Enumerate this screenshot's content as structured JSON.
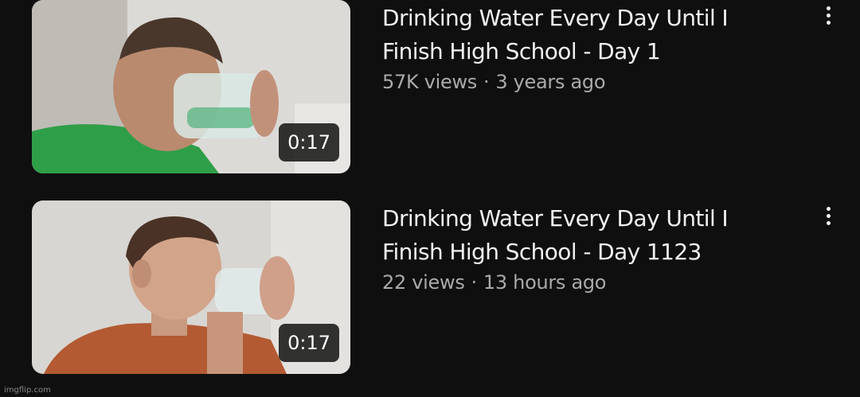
{
  "videos": [
    {
      "title_line1": "Drinking Water Every Day Until I",
      "title_line2": "Finish High School - Day 1",
      "views": "57K views",
      "age": "3 years ago",
      "duration": "0:17",
      "menu_icon": "more-vert-icon"
    },
    {
      "title_line1": "Drinking Water Every Day Until I",
      "title_line2": "Finish High School - Day 1123",
      "views": "22 views",
      "age": "13 hours ago",
      "duration": "0:17",
      "menu_icon": "more-vert-icon"
    }
  ],
  "separator": "·",
  "watermark": "imgflip.com",
  "colors": {
    "background": "#0f0f0f",
    "title_text": "#f1f1f1",
    "meta_text": "#aaaaaa"
  }
}
